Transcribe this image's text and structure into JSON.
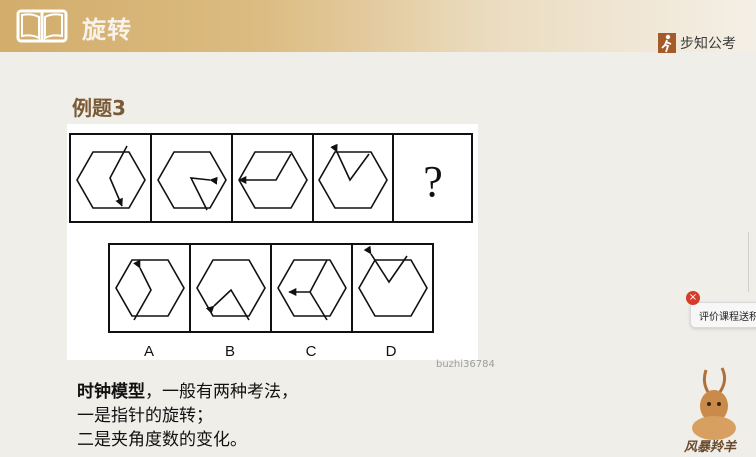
{
  "header": {
    "title": "旋转",
    "brand_logo_text": "步知公考"
  },
  "example": {
    "title": "例题3"
  },
  "puzzle": {
    "question_mark": "?",
    "options": [
      "A",
      "B",
      "C",
      "D"
    ],
    "icon_names": [
      "hexagon-clock-figure"
    ]
  },
  "watermark": "buzhi36784",
  "explanation": {
    "bold_term": "时钟模型",
    "line1_rest": "，一般有两种考法，",
    "line2": "一是指针的旋转；",
    "line3": "二是夹角度数的变化。"
  },
  "rating_tab": {
    "label": "评价课程送积分",
    "close": "×"
  },
  "brand_corner": {
    "name": "风暴羚羊"
  },
  "colors": {
    "header_accent": "#d2ad6c",
    "example_title": "#7a5b36",
    "close_badge": "#d93b2b"
  }
}
